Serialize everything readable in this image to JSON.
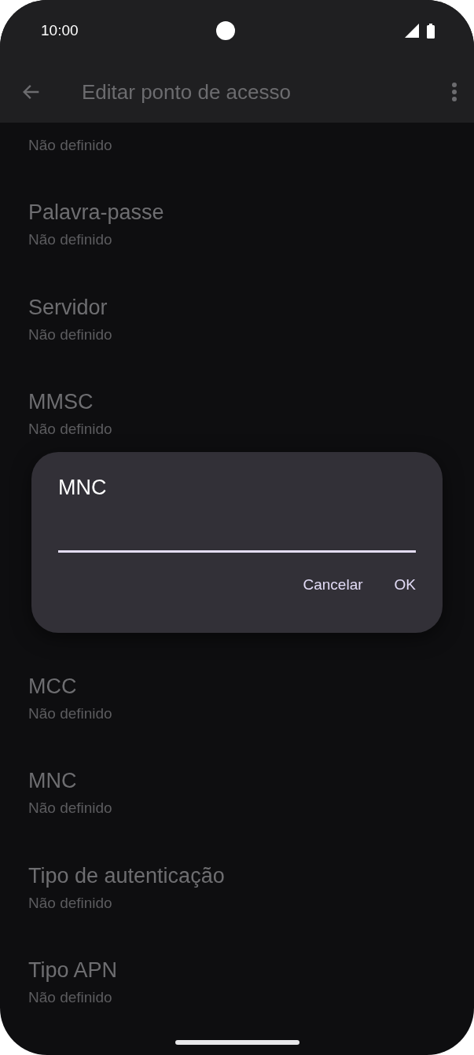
{
  "status_bar": {
    "time": "10:00"
  },
  "app_bar": {
    "title": "Editar ponto de acesso"
  },
  "settings": [
    {
      "value": "Não definido",
      "kind": "cut"
    },
    {
      "title": "Palavra-passe",
      "value": "Não definido",
      "kind": "row"
    },
    {
      "title": "Servidor",
      "value": "Não definido",
      "kind": "row"
    },
    {
      "title": "MMSC",
      "value": "Não definido",
      "kind": "row"
    },
    {
      "kind": "covered"
    },
    {
      "title": "MCC",
      "value": "Não definido",
      "kind": "row"
    },
    {
      "title": "MNC",
      "value": "Não definido",
      "kind": "row"
    },
    {
      "title": "Tipo de autenticação",
      "value": "Não definido",
      "kind": "row"
    },
    {
      "title": "Tipo APN",
      "value": "Não definido",
      "kind": "row"
    }
  ],
  "dialog": {
    "title": "MNC",
    "buttons": [
      "Cancelar",
      "OK"
    ]
  }
}
